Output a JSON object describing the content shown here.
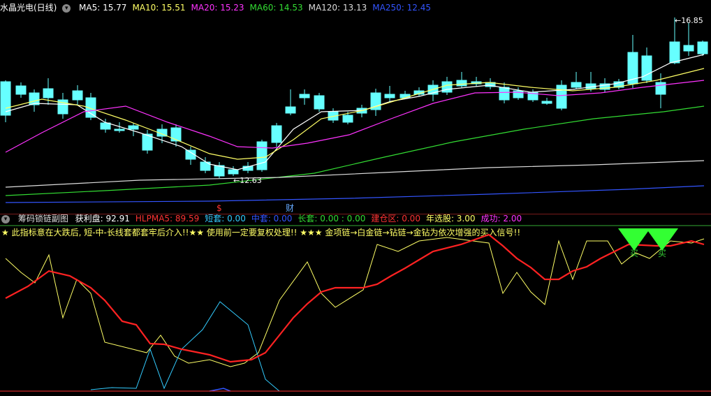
{
  "main_panel": {
    "title": "水晶光电(日线)",
    "ma_labels": [
      {
        "text": "MA5: 15.77",
        "color": "#ffffff"
      },
      {
        "text": "MA10: 15.51",
        "color": "#ffff66"
      },
      {
        "text": "MA20: 15.23",
        "color": "#ff33ff"
      },
      {
        "text": "MA60: 14.53",
        "color": "#33dd33"
      },
      {
        "text": "MA120: 13.13",
        "color": "#dddddd"
      },
      {
        "text": "MA250: 12.45",
        "color": "#3355ff"
      }
    ],
    "high_label": "16.85",
    "low_label": "12.63",
    "event_markers": [
      {
        "text": "$",
        "color": "#ff3333"
      },
      {
        "text": "财",
        "color": "#66aaff"
      }
    ],
    "colors": {
      "up": "#ff3333",
      "down": "#66ffff",
      "background": "#000000"
    }
  },
  "sub_panel": {
    "title": "筹码锁链副图",
    "values": [
      {
        "text": "获利盘: 92.91",
        "color": "#ffffff"
      },
      {
        "text": "HLPMA5: 89.59",
        "color": "#ff3333"
      },
      {
        "text": "短套: 0.00",
        "color": "#33ccff"
      },
      {
        "text": "中套: 0.00",
        "color": "#3355ff"
      },
      {
        "text": "长套: 0.00 : 0.00",
        "color": "#33dd33"
      },
      {
        "text": "建仓区: 0.00",
        "color": "#ff3333"
      },
      {
        "text": "年选股: 3.00",
        "color": "#ffff66"
      },
      {
        "text": "成功: 2.00",
        "color": "#ff33ff"
      }
    ],
    "notice": "★ 此指标意在大跌后, 短-中-长线套都套牢后介入!!★★ 使用前一定要复权处理!! ★★★ 金项链→白金链→钻链→金钻为依次增强的买入信号!!",
    "signal_label": "买"
  }
}
